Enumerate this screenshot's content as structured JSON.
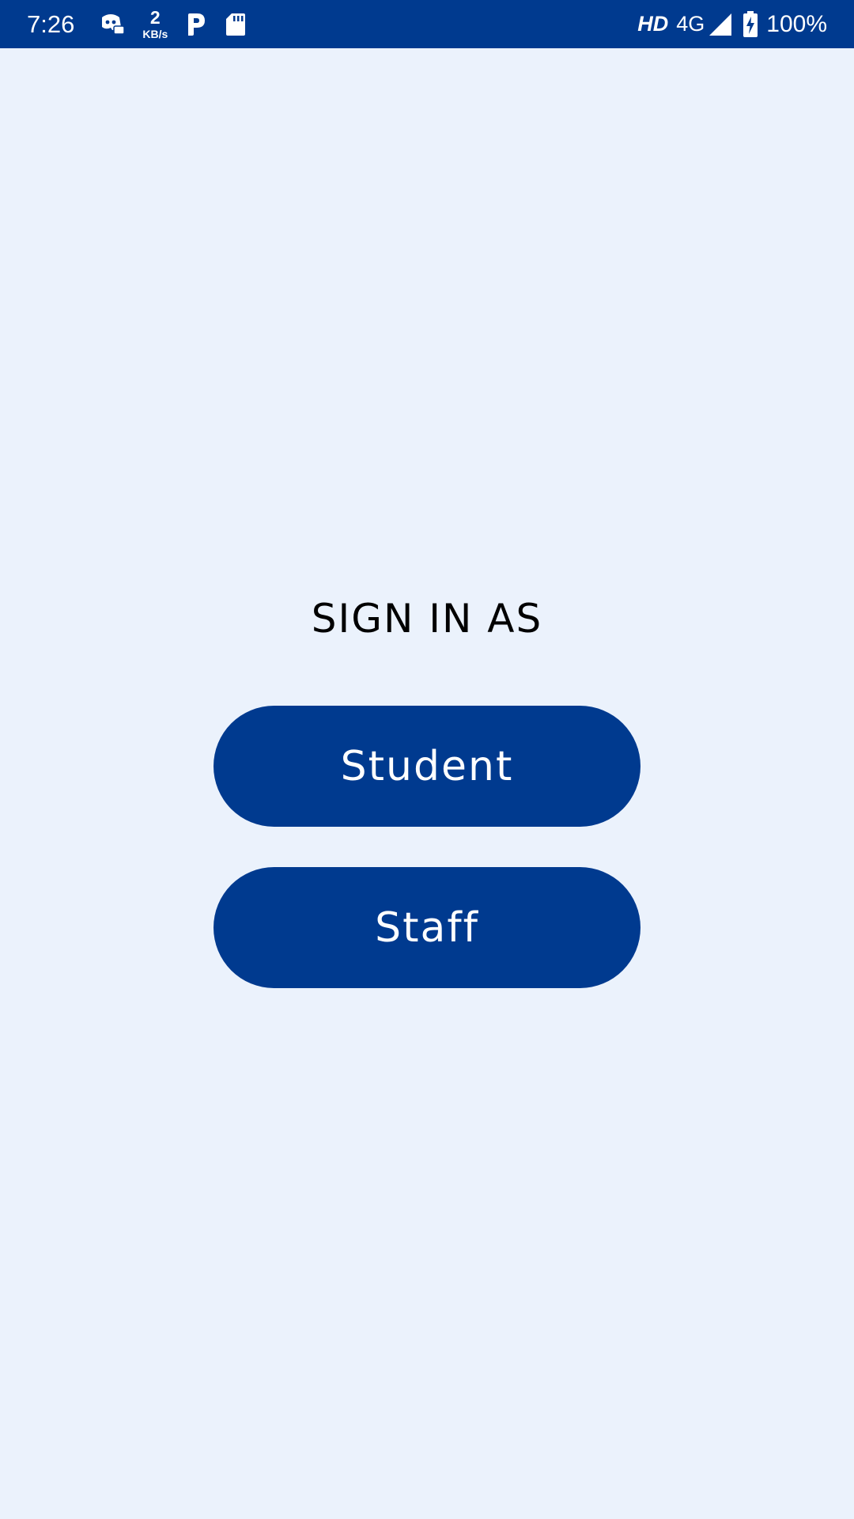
{
  "status_bar": {
    "time": "7:26",
    "net_speed_value": "2",
    "net_speed_unit": "KB/s",
    "hd_label": "HD",
    "network_type": "4G",
    "battery_percent": "100%",
    "icons": [
      "discord-icon",
      "paytm-icon",
      "sd-card-icon",
      "signal-icon",
      "battery-charging-icon"
    ],
    "background_color": "#003A8F"
  },
  "main": {
    "title": "SIGN IN AS",
    "buttons": [
      {
        "label": "Student"
      },
      {
        "label": "Staff"
      }
    ],
    "button_color": "#003A8F",
    "background_color": "#EBF2FC"
  }
}
